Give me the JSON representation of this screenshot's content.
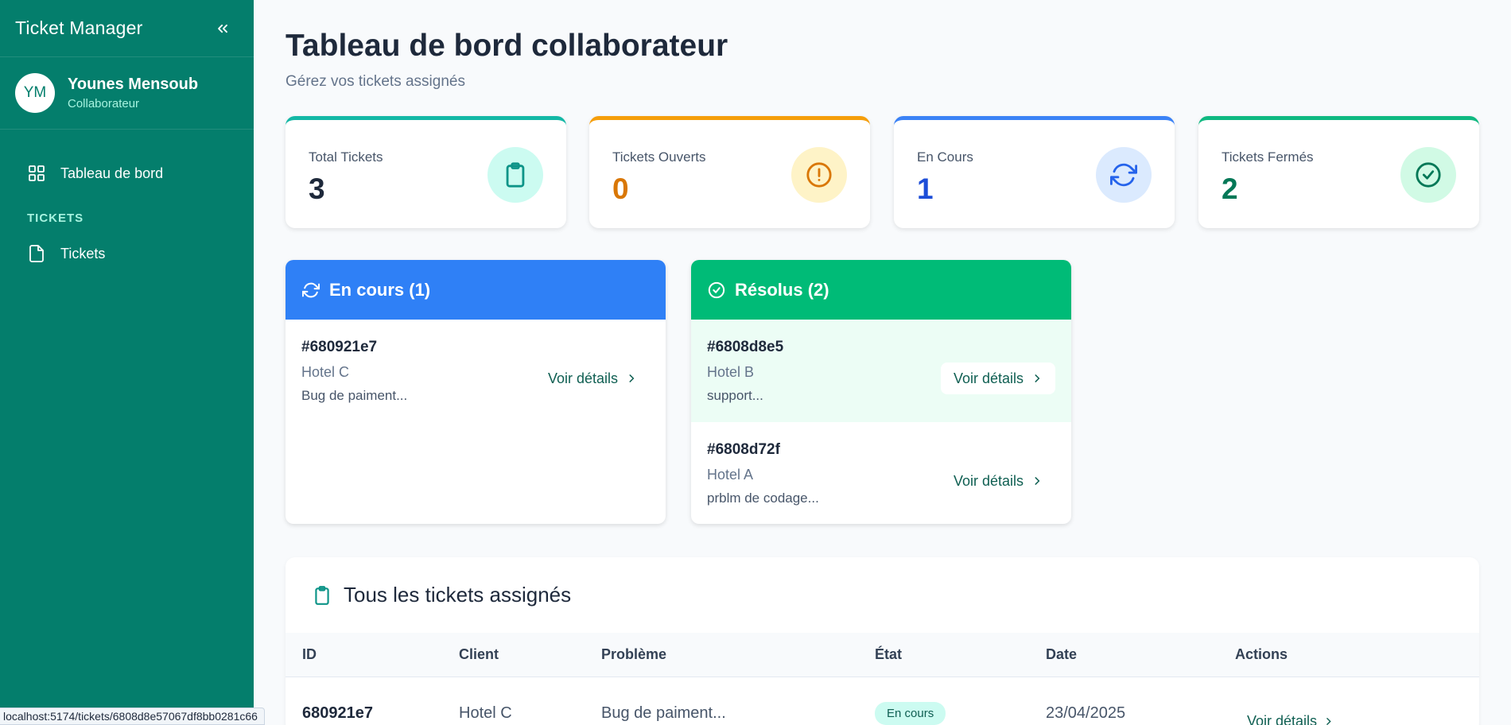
{
  "app": {
    "title": "Ticket Manager"
  },
  "user": {
    "initials": "YM",
    "name": "Younes Mensoub",
    "role": "Collaborateur"
  },
  "sidebar": {
    "items": [
      {
        "label": "Tableau de bord",
        "icon": "grid-icon"
      }
    ],
    "section": "TICKETS",
    "section_items": [
      {
        "label": "Tickets",
        "icon": "file-icon"
      }
    ]
  },
  "page": {
    "title": "Tableau de bord collaborateur",
    "subtitle": "Gérez vos tickets assignés"
  },
  "stats": [
    {
      "label": "Total Tickets",
      "value": "3",
      "color": "#14b8a6",
      "icon": "clipboard-icon"
    },
    {
      "label": "Tickets Ouverts",
      "value": "0",
      "color": "#f59e0b",
      "icon": "alert-circle-icon"
    },
    {
      "label": "En Cours",
      "value": "1",
      "color": "#3b82f6",
      "icon": "refresh-icon"
    },
    {
      "label": "Tickets Fermés",
      "value": "2",
      "color": "#10b981",
      "icon": "check-circle-icon"
    }
  ],
  "panels": {
    "in_progress": {
      "title": "En cours (1)",
      "color": "#2f80f6",
      "items": [
        {
          "id": "#680921e7",
          "client": "Hotel C",
          "desc": "Bug de paiment...",
          "link": "Voir détails"
        }
      ]
    },
    "resolved": {
      "title": "Résolus (2)",
      "color": "#00bb77",
      "items": [
        {
          "id": "#6808d8e5",
          "client": "Hotel B",
          "desc": "support...",
          "link": "Voir détails"
        },
        {
          "id": "#6808d72f",
          "client": "Hotel A",
          "desc": "prblm de codage...",
          "link": "Voir détails"
        }
      ]
    }
  },
  "table": {
    "title": "Tous les tickets assignés",
    "headers": [
      "ID",
      "Client",
      "Problème",
      "État",
      "Date",
      "Actions"
    ],
    "rows": [
      {
        "id": "680921e7",
        "client": "Hotel C",
        "problem": "Bug de paiment...",
        "state": "En cours",
        "date": "23/04/2025",
        "action": "Voir détails"
      }
    ]
  },
  "statusbar": {
    "url": "localhost:5174/tickets/6808d8e57067df8bb0281c66"
  }
}
